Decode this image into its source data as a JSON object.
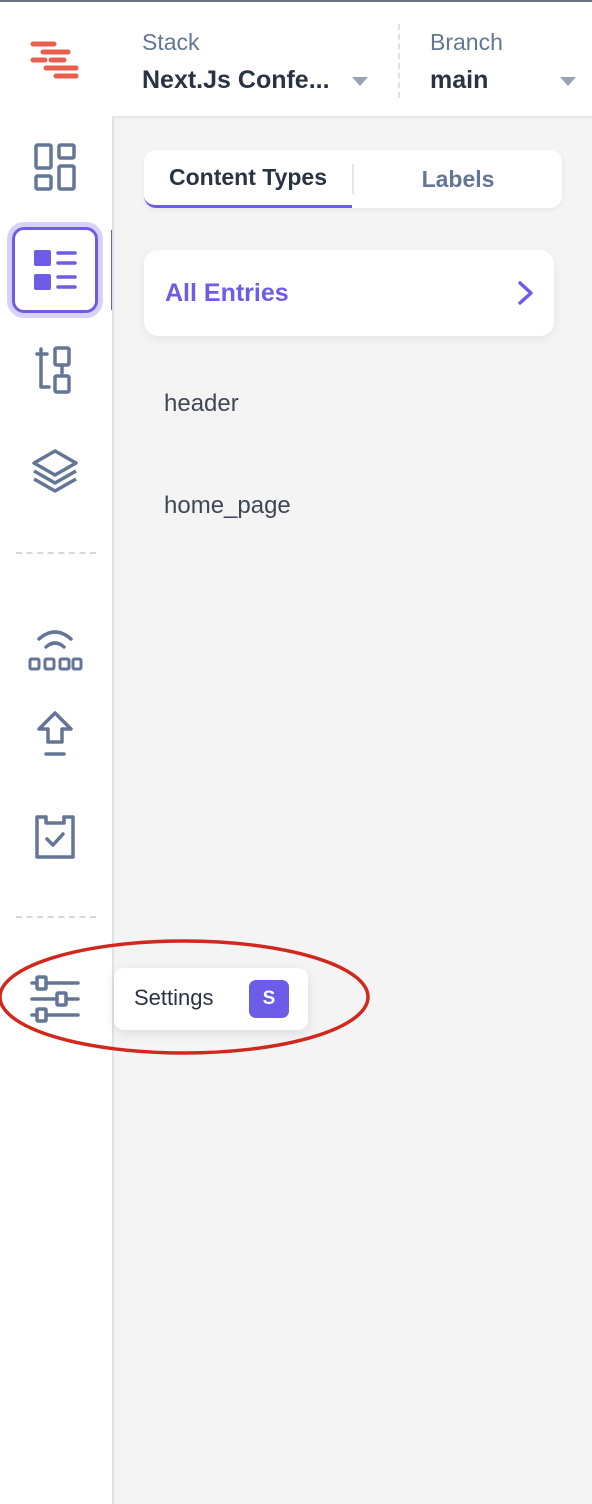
{
  "header": {
    "stack_label": "Stack",
    "stack_value": "Next.Js Confe...",
    "branch_label": "Branch",
    "branch_value": "main"
  },
  "rail": {
    "items": [
      {
        "icon": "dashboard-icon",
        "active": false
      },
      {
        "icon": "entries-list-icon",
        "active": true
      },
      {
        "icon": "content-model-tree-icon",
        "active": false
      },
      {
        "icon": "layers-icon",
        "active": false
      },
      {
        "icon": "signal-icon",
        "active": false
      },
      {
        "icon": "publish-upload-icon",
        "active": false
      },
      {
        "icon": "clipboard-check-icon",
        "active": false
      },
      {
        "icon": "settings-sliders-icon",
        "active": false
      }
    ]
  },
  "tabs": {
    "content_types": "Content Types",
    "labels": "Labels",
    "active": "content_types"
  },
  "all_entries": {
    "label": "All Entries"
  },
  "content_types": [
    "header",
    "home_page"
  ],
  "tooltip": {
    "label": "Settings",
    "shortcut": "S"
  },
  "colors": {
    "accent": "#6c5ce7",
    "logo_red": "#e8604c",
    "icon_slate": "#647696",
    "panel_bg": "#f4f4f5",
    "annotation_red": "#d0281c"
  }
}
